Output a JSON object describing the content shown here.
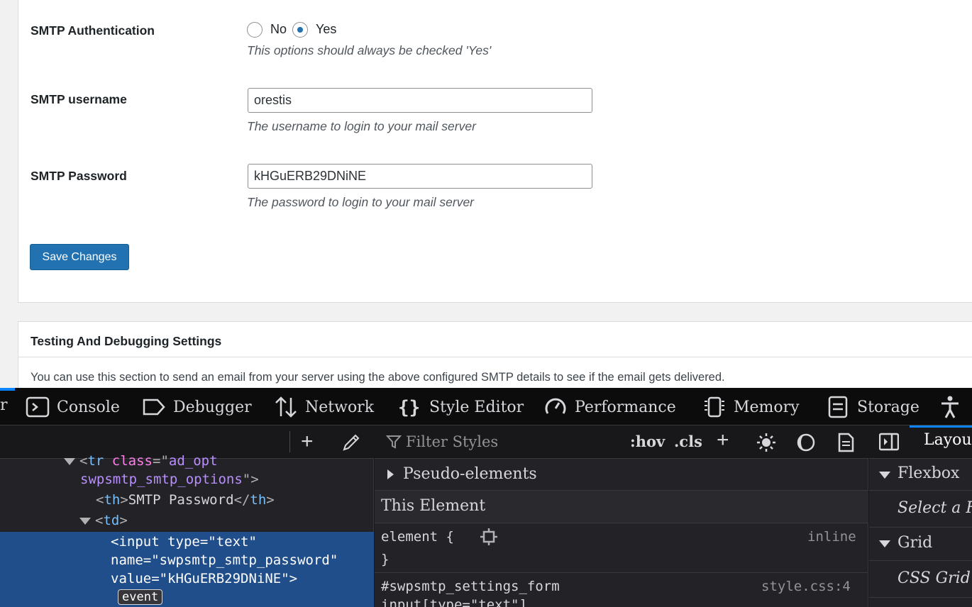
{
  "settings": {
    "auth_label": "SMTP Authentication",
    "auth_no": "No",
    "auth_yes": "Yes",
    "auth_selected": "Yes",
    "auth_desc": "This options should always be checked 'Yes'",
    "username_label": "SMTP username",
    "username_value": "orestis",
    "username_desc": "The username to login to your mail server",
    "password_label": "SMTP Password",
    "password_value": "kHGuERB29DNiNE",
    "password_desc": "The password to login to your mail server",
    "save_label": "Save Changes"
  },
  "testing": {
    "title": "Testing And Debugging Settings",
    "description": "You can use this section to send an email from your server using the above configured SMTP details to see if the email gets delivered."
  },
  "devtools": {
    "partial_tab": "r",
    "tabs": [
      {
        "label": "Console",
        "icon": "console-icon"
      },
      {
        "label": "Debugger",
        "icon": "debugger-icon"
      },
      {
        "label": "Network",
        "icon": "network-icon"
      },
      {
        "label": "Style Editor",
        "icon": "style-editor-icon"
      },
      {
        "label": "Performance",
        "icon": "performance-icon"
      },
      {
        "label": "Memory",
        "icon": "memory-icon"
      },
      {
        "label": "Storage",
        "icon": "storage-icon"
      },
      {
        "label": "",
        "icon": "accessibility-icon"
      }
    ],
    "markup": {
      "line1_tag": "tr",
      "line1_attr": "class",
      "line1_val_a": "ad_opt",
      "line2_val_b": "swpsmtp_smtp_options",
      "line3_open": "th",
      "line3_text": "SMTP Password",
      "line3_close": "th",
      "line4_tag": "td",
      "sel_line1": "<input type=\"text\"",
      "sel_line2": "name=\"swpsmtp_smtp_password\"",
      "sel_line3": "value=\"kHGuERB29DNiNE\">",
      "event_badge": "event"
    },
    "rules": {
      "filter_placeholder": "Filter Styles",
      "hov": ":hov",
      "cls": ".cls",
      "pseudo_elements": "Pseudo-elements",
      "this_element": "This Element",
      "element_selector": "element {",
      "element_close": "}",
      "element_source": "inline",
      "rule2_selector": "#swpsmtp_settings_form",
      "rule2_selector_cont": "input[type=\"text\"]",
      "rule2_source": "style.css:4"
    },
    "layout": {
      "tab": "Layout",
      "flexbox": "Flexbox",
      "flexbox_hint": "Select a Flex",
      "grid": "Grid",
      "grid_hint": "CSS Grid is"
    }
  },
  "colors": {
    "wp_primary": "#2271b1",
    "devtools_bg": "#232327",
    "selection": "#204e8a",
    "accent": "#0a84ff"
  }
}
